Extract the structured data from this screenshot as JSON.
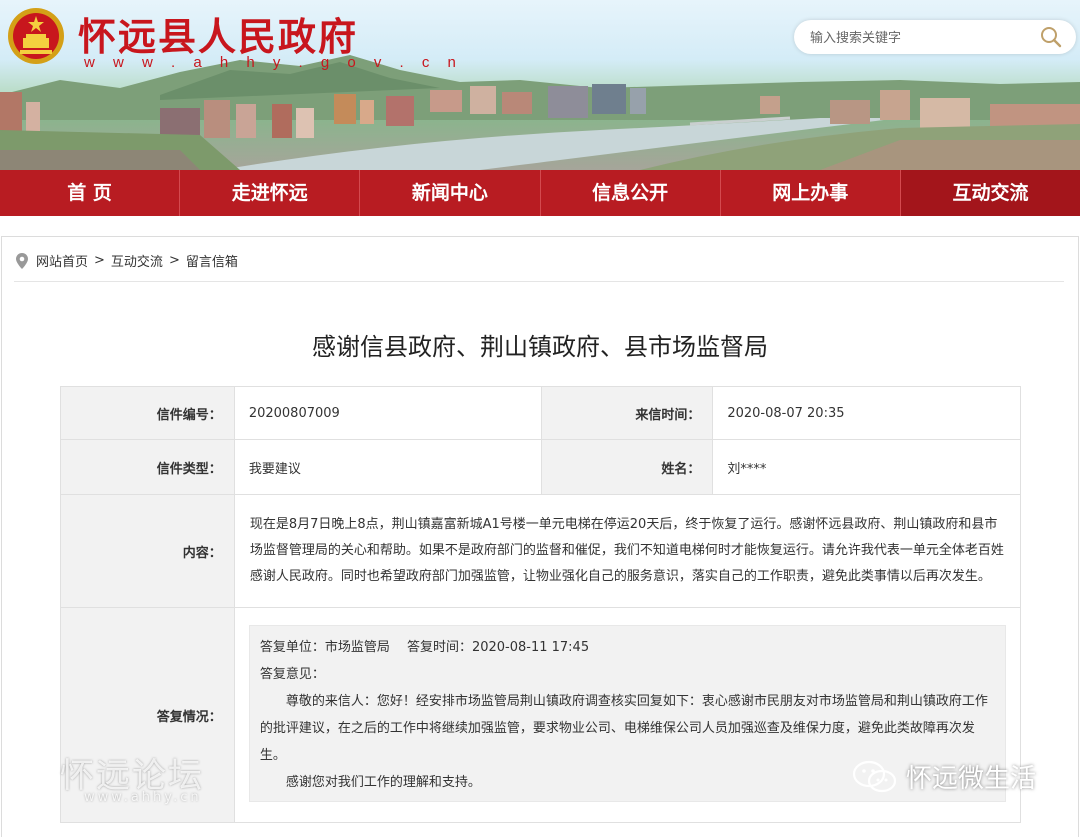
{
  "header": {
    "site_title": "怀远县人民政府",
    "site_url": "w w w . a h h y . g o v . c n",
    "search_placeholder": "输入搜索关键字"
  },
  "nav": {
    "items": [
      "首 页",
      "走进怀远",
      "新闻中心",
      "信息公开",
      "网上办事",
      "互动交流"
    ]
  },
  "breadcrumb": {
    "items": [
      "网站首页",
      "互动交流",
      "留言信箱"
    ],
    "separator": ">"
  },
  "page_title": "感谢信县政府、荆山镇政府、县市场监督局",
  "letter": {
    "id_label": "信件编号：",
    "id_value": "20200807009",
    "time_label": "来信时间：",
    "time_value": "2020-08-07 20:35",
    "type_label": "信件类型：",
    "type_value": "我要建议",
    "name_label": "姓名：",
    "name_value": "刘****",
    "content_label": "内容：",
    "content_text": "现在是8月7日晚上8点，荆山镇嘉富新城A1号楼一单元电梯在停运20天后，终于恢复了运行。感谢怀远县政府、荆山镇政府和县市场监督管理局的关心和帮助。如果不是政府部门的监督和催促，我们不知道电梯何时才能恢复运行。请允许我代表一单元全体老百姓感谢人民政府。同时也希望政府部门加强监管，让物业强化自己的服务意识，落实自己的工作职责，避免此类事情以后再次发生。",
    "reply_label": "答复情况：",
    "reply_unit_line": "答复单位：市场监管局　 答复时间：2020-08-11 17:45",
    "reply_opinion_label": "答复意见：",
    "reply_para1": "尊敬的来信人：您好！经安排市场监管局荆山镇政府调查核实回复如下：衷心感谢市民朋友对市场监管局和荆山镇政府工作的批评建议，在之后的工作中将继续加强监管，要求物业公司、电梯维保公司人员加强巡查及维保力度，避免此类故障再次发生。",
    "reply_para2": "感谢您对我们工作的理解和支持。"
  },
  "watermarks": {
    "left_text": "怀远论坛",
    "left_sub": "www.ahhy.cn",
    "right_text": "怀远微生活"
  },
  "colors": {
    "brand_red": "#c8161d",
    "nav_red": "#b81c22",
    "label_bg": "#f2f2f2"
  }
}
